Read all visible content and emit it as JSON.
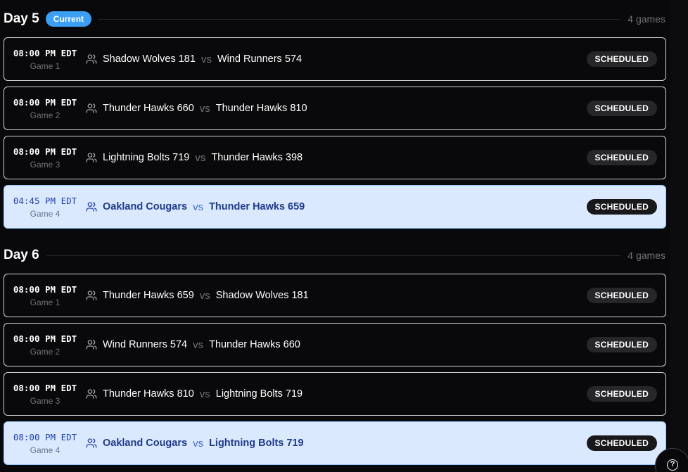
{
  "days": [
    {
      "title": "Day 5",
      "badge": "Current",
      "count": "4 games",
      "games": [
        {
          "time": "08:00 PM EDT",
          "game": "Game 1",
          "home": "Shadow Wolves 181",
          "vs": "vs",
          "away": "Wind Runners 574",
          "status": "SCHEDULED",
          "highlight": false
        },
        {
          "time": "08:00 PM EDT",
          "game": "Game 2",
          "home": "Thunder Hawks 660",
          "vs": "vs",
          "away": "Thunder Hawks 810",
          "status": "SCHEDULED",
          "highlight": false
        },
        {
          "time": "08:00 PM EDT",
          "game": "Game 3",
          "home": "Lightning Bolts 719",
          "vs": "vs",
          "away": "Thunder Hawks 398",
          "status": "SCHEDULED",
          "highlight": false
        },
        {
          "time": "04:45 PM EDT",
          "game": "Game 4",
          "home": "Oakland Cougars",
          "vs": "vs",
          "away": "Thunder Hawks 659",
          "status": "SCHEDULED",
          "highlight": true
        }
      ]
    },
    {
      "title": "Day 6",
      "badge": "",
      "count": "4 games",
      "games": [
        {
          "time": "08:00 PM EDT",
          "game": "Game 1",
          "home": "Thunder Hawks 659",
          "vs": "vs",
          "away": "Shadow Wolves 181",
          "status": "SCHEDULED",
          "highlight": false
        },
        {
          "time": "08:00 PM EDT",
          "game": "Game 2",
          "home": "Wind Runners 574",
          "vs": "vs",
          "away": "Thunder Hawks 660",
          "status": "SCHEDULED",
          "highlight": false
        },
        {
          "time": "08:00 PM EDT",
          "game": "Game 3",
          "home": "Thunder Hawks 810",
          "vs": "vs",
          "away": "Lightning Bolts 719",
          "status": "SCHEDULED",
          "highlight": false
        },
        {
          "time": "08:00 PM EDT",
          "game": "Game 4",
          "home": "Oakland Cougars",
          "vs": "vs",
          "away": "Lightning Bolts 719",
          "status": "SCHEDULED",
          "highlight": true
        }
      ]
    }
  ],
  "help": {
    "icon": "help-circle-icon",
    "glyph": "?"
  },
  "colors": {
    "background": "#09090b",
    "accent": "#3b9ff5",
    "highlight_row": "#dbe9ff",
    "highlight_text": "#1e3a8a"
  }
}
